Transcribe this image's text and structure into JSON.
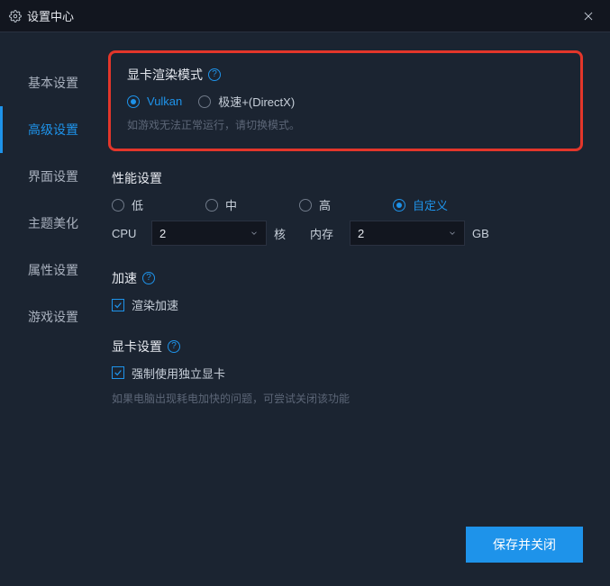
{
  "titlebar": {
    "title": "设置中心"
  },
  "sidebar": {
    "items": [
      {
        "label": "基本设置"
      },
      {
        "label": "高级设置"
      },
      {
        "label": "界面设置"
      },
      {
        "label": "主题美化"
      },
      {
        "label": "属性设置"
      },
      {
        "label": "游戏设置"
      }
    ],
    "active_index": 1
  },
  "render_mode": {
    "title": "显卡渲染模式",
    "options": [
      {
        "label": "Vulkan",
        "selected": true
      },
      {
        "label": "极速+(DirectX)",
        "selected": false
      }
    ],
    "hint": "如游戏无法正常运行，请切换模式。"
  },
  "performance": {
    "title": "性能设置",
    "options": [
      {
        "label": "低",
        "selected": false
      },
      {
        "label": "中",
        "selected": false
      },
      {
        "label": "高",
        "selected": false
      },
      {
        "label": "自定义",
        "selected": true
      }
    ],
    "cpu_label": "CPU",
    "cpu_value": "2",
    "cpu_unit": "核",
    "mem_label": "内存",
    "mem_value": "2",
    "mem_unit": "GB"
  },
  "accel": {
    "title": "加速",
    "checkbox_label": "渲染加速",
    "checked": true
  },
  "gpu": {
    "title": "显卡设置",
    "checkbox_label": "强制使用独立显卡",
    "checked": true,
    "hint": "如果电脑出现耗电加快的问题，可尝试关闭该功能"
  },
  "save_button": "保存并关闭"
}
